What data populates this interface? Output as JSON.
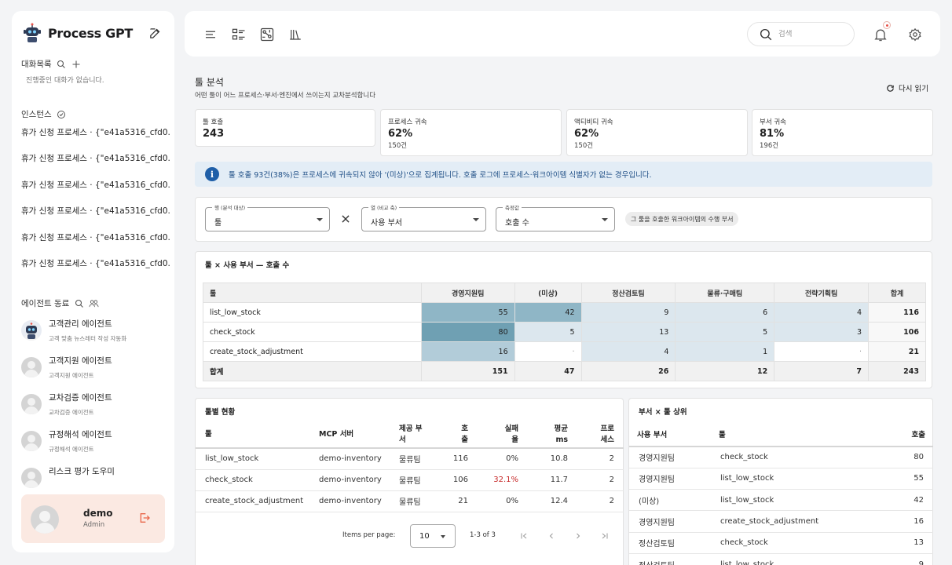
{
  "sidebar": {
    "brand": "Process GPT",
    "conversations_title": "대화목록",
    "empty_message": "진행중인 대화가 없습니다.",
    "instances_title": "인스턴스",
    "instances": [
      "휴가 신청 프로세스 · {\"e41a5316_cfd0...",
      "휴가 신청 프로세스 · {\"e41a5316_cfd0...",
      "휴가 신청 프로세스 · {\"e41a5316_cfd0...",
      "휴가 신청 프로세스 · {\"e41a5316_cfd0...",
      "휴가 신청 프로세스 · {\"e41a5316_cfd0...",
      "휴가 신청 프로세스 · {\"e41a5316_cfd0..."
    ],
    "agents_title": "에이전트 동료",
    "agents": [
      {
        "name": "고객관리 에이전트",
        "desc": "고객 맞춤 뉴스레터 작성 자동화",
        "avatar": "robot"
      },
      {
        "name": "고객지원 에이전트",
        "desc": "고객지원 에이전트",
        "avatar": "person"
      },
      {
        "name": "교차검증 에이전트",
        "desc": "교차검증 에이전트",
        "avatar": "person"
      },
      {
        "name": "규정해석 에이전트",
        "desc": "규정해석 에이전트",
        "avatar": "person"
      },
      {
        "name": "리스크 평가 도우미",
        "desc": "",
        "avatar": "person"
      }
    ],
    "user": {
      "name": "demo",
      "role": "Admin"
    }
  },
  "topbar": {
    "search_placeholder": "검색"
  },
  "page": {
    "title": "툴 분석",
    "subtitle": "어떤 툴이 어느 프로세스·부서·엔진에서 쓰이는지 교차분석합니다",
    "reload_label": "다시 읽기"
  },
  "kpis": [
    {
      "label": "툴 호출",
      "value": "243",
      "sub": ""
    },
    {
      "label": "프로세스 귀속",
      "value": "62%",
      "sub": "150건"
    },
    {
      "label": "액티비티 귀속",
      "value": "62%",
      "sub": "150건"
    },
    {
      "label": "부서 귀속",
      "value": "81%",
      "sub": "196건"
    }
  ],
  "alert": {
    "icon": "info-icon",
    "text": "툴 호출 93건(38%)은 프로세스에 귀속되지 않아 '(미상)'으로 집계됩니다. 호출 로그에 프로세스·워크아이템 식별자가 없는 경우입니다."
  },
  "filters": {
    "row": {
      "label": "행 (분석 대상)",
      "value": "툴"
    },
    "col": {
      "label": "열 (비교 축)",
      "value": "사용 부서"
    },
    "measure": {
      "label": "측정값",
      "value": "호출 수"
    },
    "chip": "그 툴을 호출한 워크아이템의 수행 부서"
  },
  "pivot": {
    "title": "툴 × 사용 부서 — 호출 수",
    "corner": "툴",
    "columns": [
      "경영지원팀",
      "(미상)",
      "정산검토팀",
      "물류·구매팀",
      "전략기획팀",
      "합계"
    ],
    "rows": [
      {
        "name": "list_low_stock",
        "cells": [
          "55",
          "42",
          "9",
          "6",
          "4"
        ],
        "total": "116"
      },
      {
        "name": "check_stock",
        "cells": [
          "80",
          "5",
          "13",
          "5",
          "3"
        ],
        "total": "106"
      },
      {
        "name": "create_stock_adjustment",
        "cells": [
          "16",
          "·",
          "4",
          "1",
          "·"
        ],
        "total": "21"
      }
    ],
    "totals": {
      "name": "합계",
      "cells": [
        "151",
        "47",
        "26",
        "12",
        "7"
      ],
      "total": "243"
    },
    "heat_colors": [
      "#ffffff",
      "#dce7ee",
      "#b2ccd9",
      "#8fb6c6",
      "#6fa0b3"
    ]
  },
  "tool_status": {
    "title": "툴별 현황",
    "columns": [
      "툴",
      "MCP 서버",
      "제공 부서",
      "호출",
      "실패율",
      "평균 ms",
      "프로세스"
    ],
    "rows": [
      [
        "list_low_stock",
        "demo-inventory",
        "물류팀",
        "116",
        "0%",
        "10.8",
        "2"
      ],
      [
        "check_stock",
        "demo-inventory",
        "물류팀",
        "106",
        "32.1%",
        "11.7",
        "2"
      ],
      [
        "create_stock_adjustment",
        "demo-inventory",
        "물류팀",
        "21",
        "0%",
        "12.4",
        "2"
      ]
    ],
    "pager": {
      "items_per_page_label": "Items per page:",
      "items_per_page": "10",
      "range": "1-3 of 3"
    }
  },
  "dept_top": {
    "title": "부서 × 툴 상위",
    "columns": [
      "사용 부서",
      "툴",
      "호출"
    ],
    "rows": [
      [
        "경영지원팀",
        "check_stock",
        "80"
      ],
      [
        "경영지원팀",
        "list_low_stock",
        "55"
      ],
      [
        "(미상)",
        "list_low_stock",
        "42"
      ],
      [
        "경영지원팀",
        "create_stock_adjustment",
        "16"
      ],
      [
        "정산검토팀",
        "check_stock",
        "13"
      ],
      [
        "정산검토팀",
        "list_low_stock",
        "9"
      ]
    ]
  }
}
